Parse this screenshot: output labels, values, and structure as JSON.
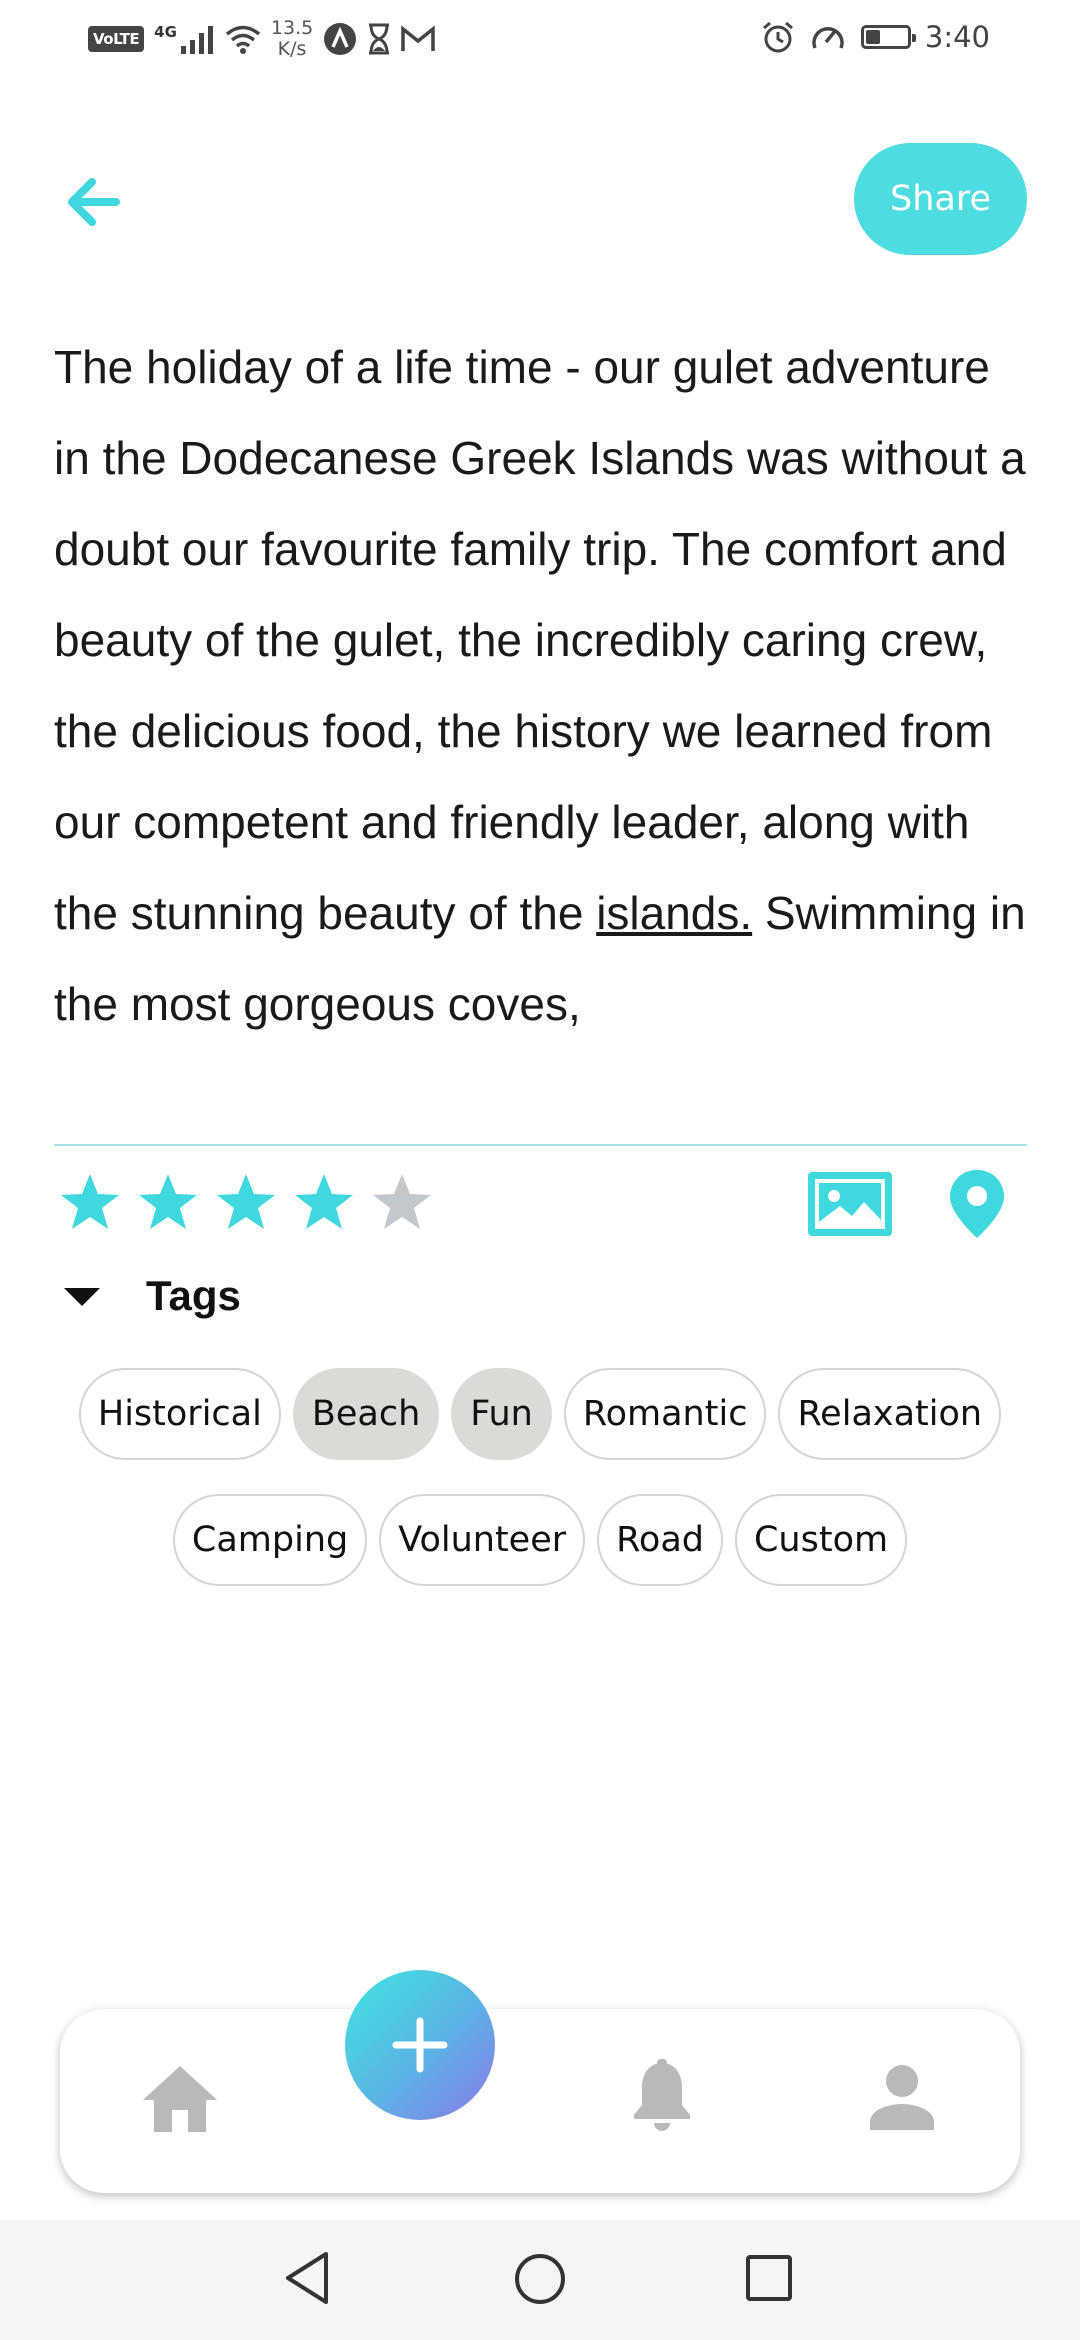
{
  "status_bar": {
    "volte": "VoLTE",
    "network_type": "4G",
    "speed_value": "13.5",
    "speed_unit": "K/s",
    "time": "3:40",
    "battery_level": 0.35,
    "icons": [
      "signal-icon",
      "wifi-icon",
      "notification-a-icon",
      "hourglass-icon",
      "gmail-icon",
      "alarm-icon",
      "data-saver-icon",
      "battery-icon"
    ]
  },
  "header": {
    "back_icon": "arrow-left-icon",
    "share_label": "Share"
  },
  "review": {
    "text_before_link": "The holiday of a life time - our gulet adventure in the Dodecanese Greek Islands was without a doubt our favourite family trip. The comfort and beauty of the gulet, the incredibly caring crew, the delicious food, the history we learned from our competent and friendly leader, along with the stunning beauty of the ",
    "link_text": "islands.",
    "text_after_link": " Swimming in the most gorgeous coves,"
  },
  "rating": {
    "value": 4,
    "max": 5
  },
  "actions": {
    "photo_icon": "image-icon",
    "location_icon": "location-pin-icon"
  },
  "tags": {
    "title": "Tags",
    "items": [
      {
        "label": "Historical",
        "selected": false
      },
      {
        "label": "Beach",
        "selected": true
      },
      {
        "label": "Fun",
        "selected": true
      },
      {
        "label": "Romantic",
        "selected": false
      },
      {
        "label": "Relaxation",
        "selected": false
      },
      {
        "label": "Camping",
        "selected": false
      },
      {
        "label": "Volunteer",
        "selected": false
      },
      {
        "label": "Road",
        "selected": false
      },
      {
        "label": "Custom",
        "selected": false
      }
    ]
  },
  "bottom_nav": {
    "items": [
      "home-icon",
      "add-icon",
      "bell-icon",
      "person-icon"
    ]
  },
  "colors": {
    "accent": "#4ddde0",
    "star_active": "#3fd8de",
    "star_inactive": "#c3c8cc",
    "tag_selected": "#dcdad6",
    "nav_icon": "#b9b9b9"
  }
}
